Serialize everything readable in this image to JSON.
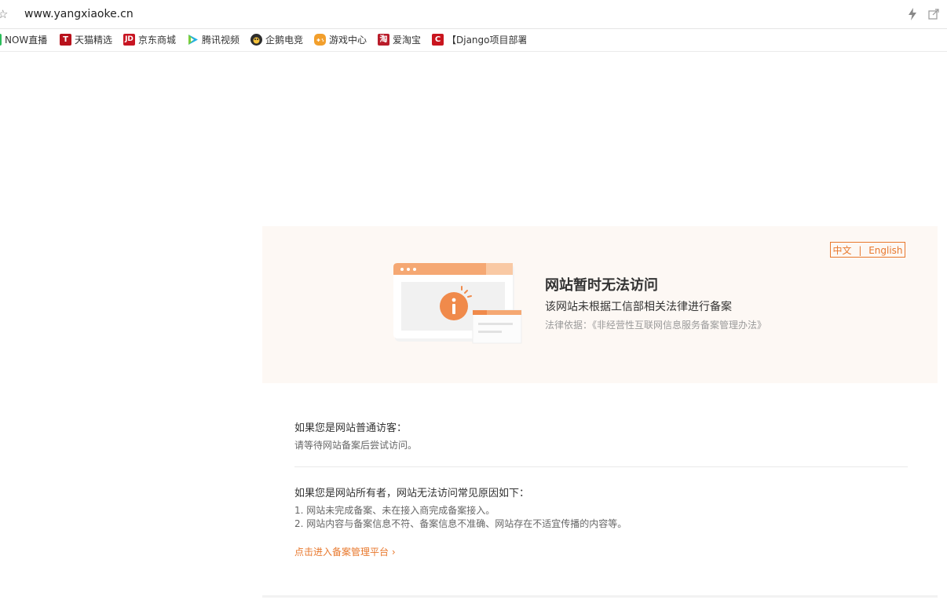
{
  "browser": {
    "url": "www.yangxiaoke.cn",
    "bookmarks": [
      {
        "label": "NOW直播",
        "icon": "now-live-icon"
      },
      {
        "label": "天猫精选",
        "icon": "tmall-icon",
        "glyph": "T"
      },
      {
        "label": "京东商城",
        "icon": "jd-icon",
        "glyph": "JD"
      },
      {
        "label": "腾讯视频",
        "icon": "tencent-video-icon"
      },
      {
        "label": "企鹅电竞",
        "icon": "penguin-esports-icon"
      },
      {
        "label": "游戏中心",
        "icon": "game-center-icon"
      },
      {
        "label": "爱淘宝",
        "icon": "ai-taobao-icon",
        "glyph": "淘"
      },
      {
        "label": "【Django项目部署",
        "icon": "csdn-icon",
        "glyph": "C"
      }
    ]
  },
  "notice": {
    "lang_zh": "中文",
    "lang_sep": "|",
    "lang_en": "English",
    "title": "网站暂时无法访问",
    "subtitle": "该网站未根据工信部相关法律进行备案",
    "law": "法律依据：《非经营性互联网信息服务备案管理办法》"
  },
  "visitor": {
    "title": "如果您是网站普通访客：",
    "line": "请等待网站备案后尝试访问。"
  },
  "owner": {
    "title": "如果您是网站所有者，网站无法访问常见原因如下：",
    "reasons": [
      "1. 网站未完成备案、未在接入商完成备案接入。",
      "2. 网站内容与备案信息不符、备案信息不准确、网站存在不适宜传播的内容等。"
    ],
    "link": "点击进入备案管理平台 ›"
  },
  "colors": {
    "accent": "#e8782d",
    "hero_bg": "#fdf8f4"
  }
}
